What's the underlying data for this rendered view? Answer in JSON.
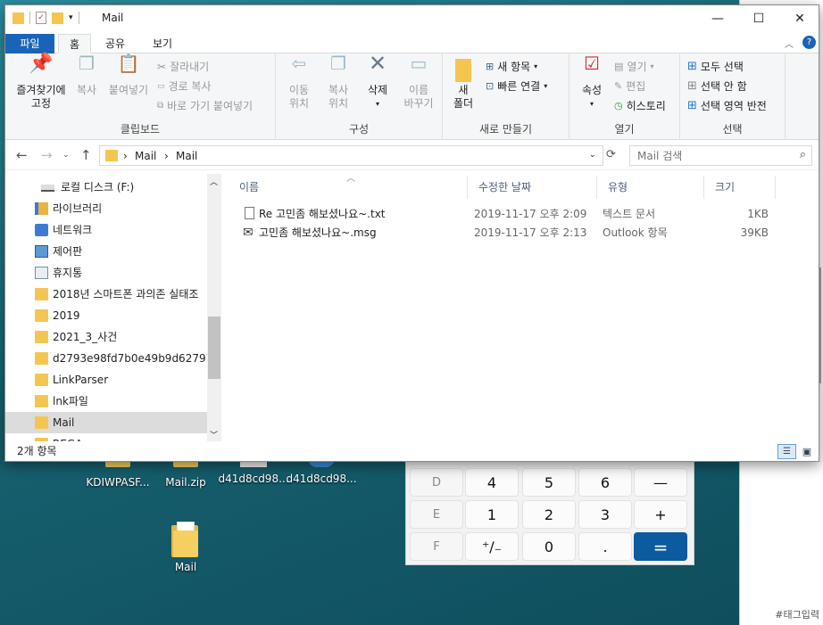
{
  "window": {
    "title": "Mail",
    "minimize": "—",
    "maximize": "☐",
    "close": "✕"
  },
  "tabs": [
    "파일",
    "홈",
    "공유",
    "보기"
  ],
  "ribbon": {
    "clipboard": {
      "group": "클립보드",
      "pin": "즐겨찾기에\n고정",
      "pin_a": "즐겨찾기에",
      "pin_b": "고정",
      "copy": "복사",
      "paste": "붙여넣기",
      "cut": "잘라내기",
      "copy_path": "경로 복사",
      "paste_shortcut": "바로 가기 붙여넣기"
    },
    "organize": {
      "group": "구성",
      "move_a": "이동",
      "move_b": "위치",
      "copy_a": "복사",
      "copy_b": "위치",
      "delete": "삭제",
      "rename_a": "이름",
      "rename_b": "바꾸기"
    },
    "new": {
      "group": "새로 만들기",
      "folder_a": "새",
      "folder_b": "폴더",
      "new_item": "새 항목",
      "easy_access": "빠른 연결"
    },
    "open": {
      "group": "열기",
      "properties": "속성",
      "open": "열기",
      "edit": "편집",
      "history": "히스토리"
    },
    "select": {
      "group": "선택",
      "select_all": "모두 선택",
      "select_none": "선택 안 함",
      "invert": "선택 영역 반전"
    }
  },
  "address": {
    "path": [
      "Mail",
      "Mail"
    ],
    "search_placeholder": "Mail 검색"
  },
  "nav": {
    "items": [
      {
        "label": "로컬 디스크 (F:)",
        "icon": "drive-icon"
      },
      {
        "label": "라이브러리",
        "icon": "library-icon"
      },
      {
        "label": "네트워크",
        "icon": "network-icon"
      },
      {
        "label": "제어판",
        "icon": "control-panel-icon"
      },
      {
        "label": "휴지통",
        "icon": "recycle-bin-icon"
      },
      {
        "label": "2018년 스마트폰 과의존 실태조",
        "icon": "folder-icon"
      },
      {
        "label": "2019",
        "icon": "folder-icon"
      },
      {
        "label": "2021_3_사건",
        "icon": "folder-icon"
      },
      {
        "label": "d2793e98fd7b0e49b9d627970c",
        "icon": "folder-icon"
      },
      {
        "label": "LinkParser",
        "icon": "folder-icon"
      },
      {
        "label": "lnk파일",
        "icon": "folder-icon"
      },
      {
        "label": "Mail",
        "icon": "folder-icon"
      },
      {
        "label": "REGA",
        "icon": "folder-icon"
      }
    ]
  },
  "list": {
    "columns": [
      "이름",
      "수정한 날짜",
      "유형",
      "크기"
    ],
    "rows": [
      {
        "name": "Re 고민좀 해보셨나요~.txt",
        "date": "2019-11-17 오후 2:09",
        "type": "텍스트 문서",
        "size": "1KB",
        "icon": "text-file-icon"
      },
      {
        "name": "고민좀 해보셨나요~.msg",
        "date": "2019-11-17 오후 2:13",
        "type": "Outlook 항목",
        "size": "39KB",
        "icon": "mail-icon"
      }
    ]
  },
  "status": "2개 항목",
  "desktop": {
    "icons": [
      "KDIWPASF...",
      "Mail.zip",
      "d41d8cd98...",
      "d41d8cd98...",
      "Mail"
    ]
  },
  "calculator": {
    "rows": [
      [
        "D",
        "4",
        "5",
        "6",
        "—"
      ],
      [
        "E",
        "1",
        "2",
        "3",
        "+"
      ],
      [
        "F",
        "⁺∕₋",
        "0",
        ".",
        "="
      ]
    ]
  },
  "tag_input": "#태그입력"
}
